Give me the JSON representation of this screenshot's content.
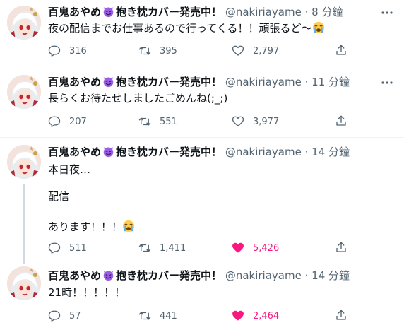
{
  "user": {
    "name": "百鬼あやめ",
    "name_suffix": "抱き枕カバー発売中！",
    "handle": "@nakiriayame",
    "separator": "·"
  },
  "icons": {
    "devil_emoji": "smiling-face-with-horns",
    "cry_emoji": "loudly-crying-face",
    "reply": "reply-icon",
    "retweet": "retweet-icon",
    "like": "heart-icon",
    "share": "share-icon",
    "more": "more-icon"
  },
  "colors": {
    "text": "#0f1419",
    "secondary": "#536471",
    "like_active": "#f91880",
    "divider": "#eff3f4",
    "thread_line": "#cfd9de"
  },
  "tweets": [
    {
      "time": "8 分鐘",
      "lines": [
        "夜の配信までお仕事あるので行ってくる！！頑張るど～"
      ],
      "trailing_emoji": "loudly-crying-face",
      "replies": "316",
      "retweets": "395",
      "likes": "2,797",
      "liked": false
    },
    {
      "time": "11 分鐘",
      "lines": [
        "長らくお待たせしましたごめんね(;_;)"
      ],
      "replies": "207",
      "retweets": "551",
      "likes": "3,977",
      "liked": false
    },
    {
      "time": "14 分鐘",
      "lines": [
        "本日夜…",
        "",
        "配信",
        "",
        "あります！！！"
      ],
      "trailing_emoji": "loudly-crying-face",
      "replies": "511",
      "retweets": "1,411",
      "likes": "5,426",
      "liked": true
    },
    {
      "time": "14 分鐘",
      "lines": [
        "21時！！！！！"
      ],
      "replies": "57",
      "retweets": "441",
      "likes": "2,464",
      "liked": true
    }
  ]
}
